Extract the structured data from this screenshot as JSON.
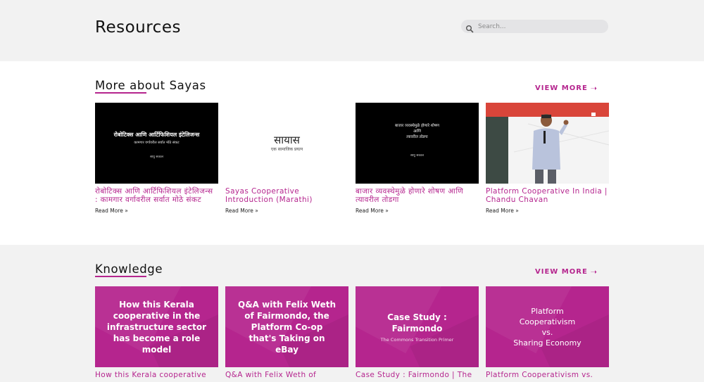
{
  "header": {
    "title": "Resources",
    "search_placeholder": "Search..."
  },
  "sections": {
    "sayas": {
      "heading": "More about Sayas",
      "view_more": "VIEW MORE",
      "cards": [
        {
          "title": "रोबोटिक्स आणि आर्टिफिशियल इंटेलिजन्स : कामगार वर्गावरील सर्वात मोठे संकट",
          "read_more": "Read More »",
          "thumb_line1": "रोबोटिक्स आणि आर्टिफिशियल इंटेलिजन्स",
          "thumb_line2": "कामगार वर्गावरील सर्वात मोठे संकट",
          "thumb_line3": "साधु सकाल"
        },
        {
          "title": "Sayas Cooperative Introduction (Marathi)",
          "read_more": "Read More »",
          "thumb_main": "सायास",
          "thumb_sub": "एक सामाजिक प्रयत्न"
        },
        {
          "title": "बाजार व्यवस्थेमुळे होणारे शोषण आणि त्यावरील तोडगा",
          "read_more": "Read More »",
          "thumb_line1": "बाजार व्यवस्थेमुळे होणारे शोषण",
          "thumb_line2": "आणि",
          "thumb_line3": "त्यावरील तोडगा",
          "thumb_line4": "साधु सकाल"
        },
        {
          "title": "Platform Cooperative In India | Chandu Chavan",
          "read_more": "Read More »"
        }
      ]
    },
    "knowledge": {
      "heading": "Knowledge",
      "view_more": "VIEW MORE",
      "tiles": [
        {
          "tile_text": "How this Kerala cooperative in the infrastructure sector has become a role model",
          "title": "How this Kerala cooperative"
        },
        {
          "tile_text": "Q&A with Felix Weth of Fairmondo, the Platform Co-op that's Taking on eBay",
          "title": "Q&A with Felix Weth of"
        },
        {
          "tile_text": "Case Study : Fairmondo",
          "tile_sub": "The Commons Transition Primer",
          "title": "Case Study : Fairmondo | The"
        },
        {
          "tile_line1": "Platform",
          "tile_line2": "Cooperativism",
          "tile_line3": "vs.",
          "tile_line4": "Sharing Economy",
          "title": "Platform Cooperativism vs."
        }
      ]
    }
  },
  "colors": {
    "accent": "#b5258e",
    "band_grey": "#f2f2f2",
    "white": "#ffffff"
  },
  "icons": {
    "search": "search-icon",
    "arrow": "arrow-right-icon"
  }
}
